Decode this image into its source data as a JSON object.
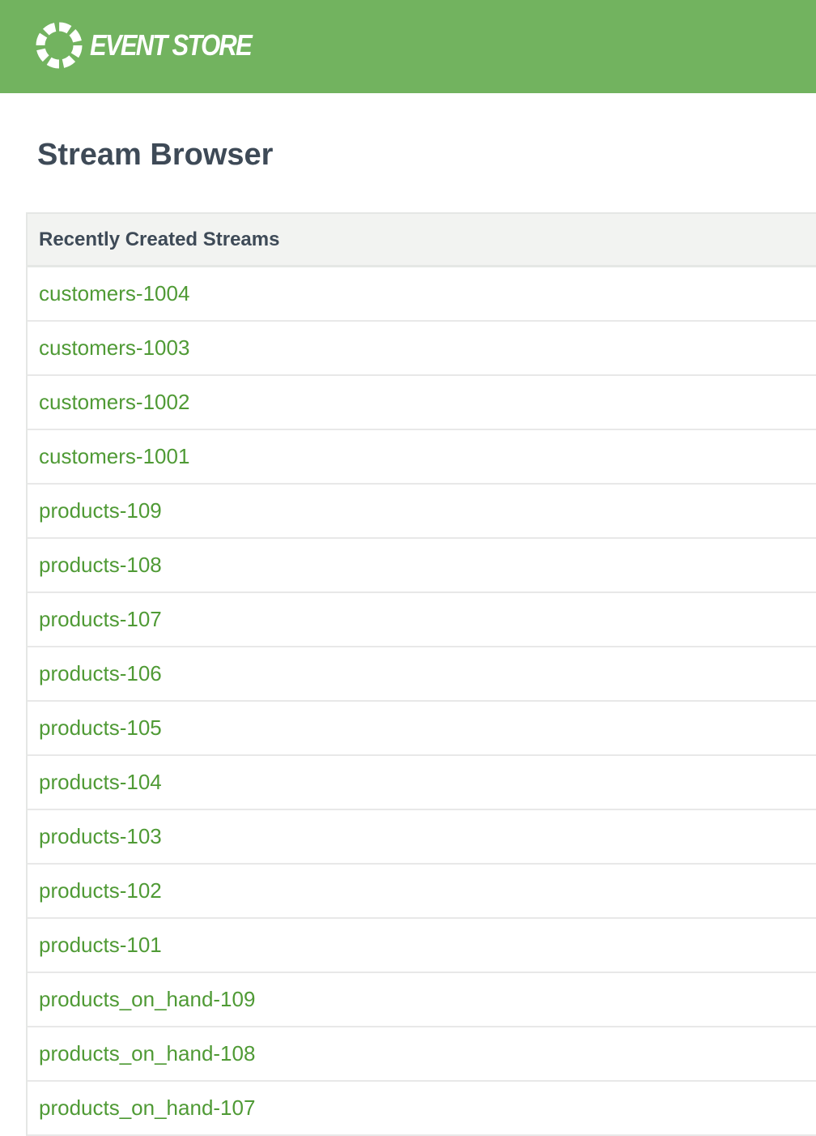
{
  "header": {
    "brand": "EVENT STORE",
    "logo_icon": "event-store-ring-logo",
    "background_color": "#72b35f"
  },
  "page": {
    "title": "Stream Browser"
  },
  "recent_streams": {
    "heading": "Recently Created Streams",
    "items": [
      "customers-1004",
      "customers-1003",
      "customers-1002",
      "customers-1001",
      "products-109",
      "products-108",
      "products-107",
      "products-106",
      "products-105",
      "products-104",
      "products-103",
      "products-102",
      "products-101",
      "products_on_hand-109",
      "products_on_hand-108",
      "products_on_hand-107"
    ],
    "link_color": "#4f9a35"
  }
}
